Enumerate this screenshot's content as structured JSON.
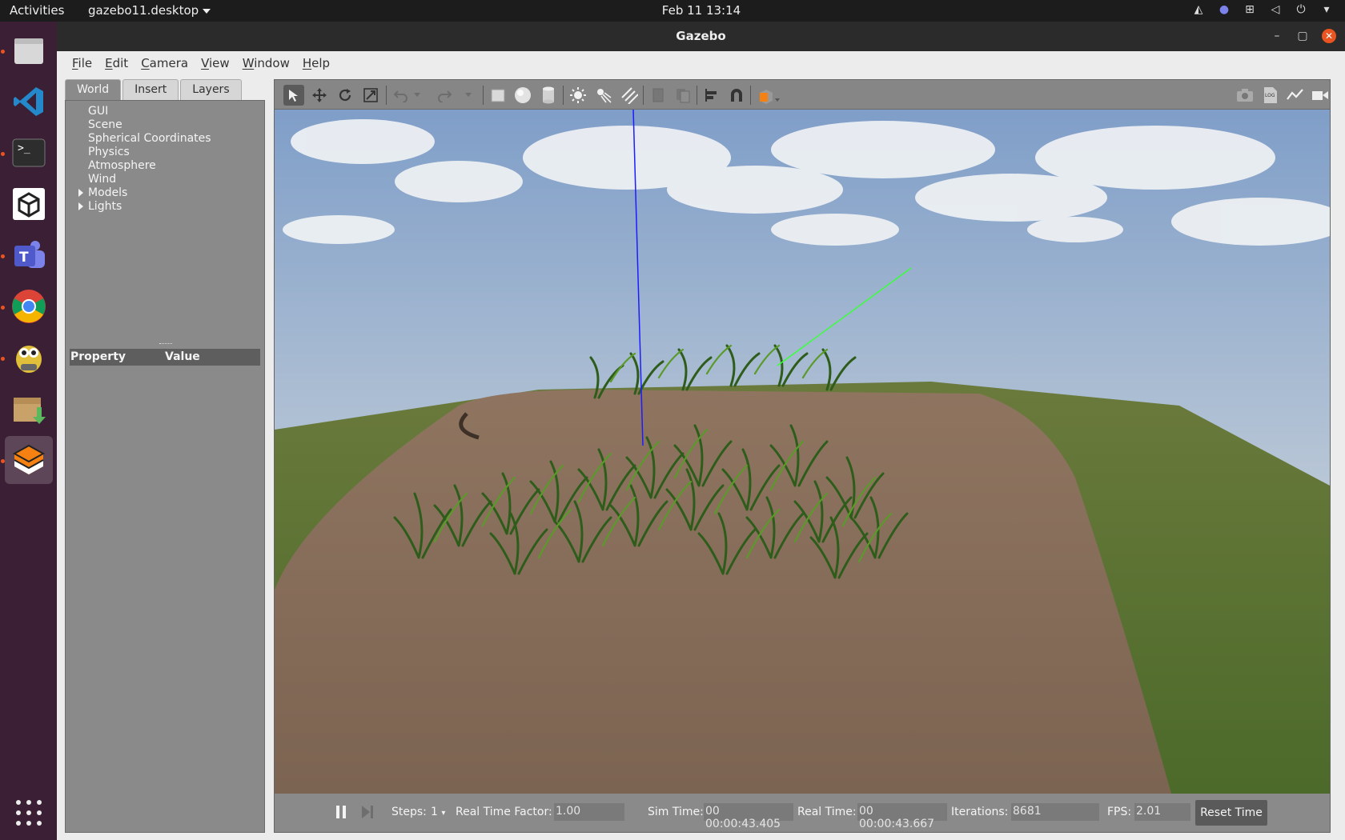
{
  "topbar": {
    "activities": "Activities",
    "app_menu": "gazebo11.desktop",
    "datetime": "Feb 11  13:14"
  },
  "dock": {
    "items": [
      "files-icon",
      "vscode-icon",
      "terminal-icon",
      "unity-icon",
      "teams-icon",
      "chrome-icon",
      "robot-icon",
      "installer-icon",
      "gazebo-icon"
    ]
  },
  "window": {
    "title": "Gazebo"
  },
  "menubar": {
    "items": [
      "File",
      "Edit",
      "Camera",
      "View",
      "Window",
      "Help"
    ]
  },
  "left_panel": {
    "tabs": [
      "World",
      "Insert",
      "Layers"
    ],
    "active_tab": "World",
    "tree": [
      {
        "label": "GUI",
        "expandable": false
      },
      {
        "label": "Scene",
        "expandable": false
      },
      {
        "label": "Spherical Coordinates",
        "expandable": false
      },
      {
        "label": "Physics",
        "expandable": false
      },
      {
        "label": "Atmosphere",
        "expandable": false
      },
      {
        "label": "Wind",
        "expandable": false
      },
      {
        "label": "Models",
        "expandable": true
      },
      {
        "label": "Lights",
        "expandable": true
      }
    ],
    "property_header": {
      "property": "Property",
      "value": "Value"
    }
  },
  "bottom_bar": {
    "steps_label": "Steps:",
    "steps_value": "1",
    "rtf_label": "Real Time Factor:",
    "rtf_value": "1.00",
    "sim_time_label": "Sim Time:",
    "sim_time_value": "00 00:00:43.405",
    "real_time_label": "Real Time:",
    "real_time_value": "00 00:00:43.667",
    "iterations_label": "Iterations:",
    "iterations_value": "8681",
    "fps_label": "FPS:",
    "fps_value": "2.01",
    "reset_label": "Reset Time"
  }
}
